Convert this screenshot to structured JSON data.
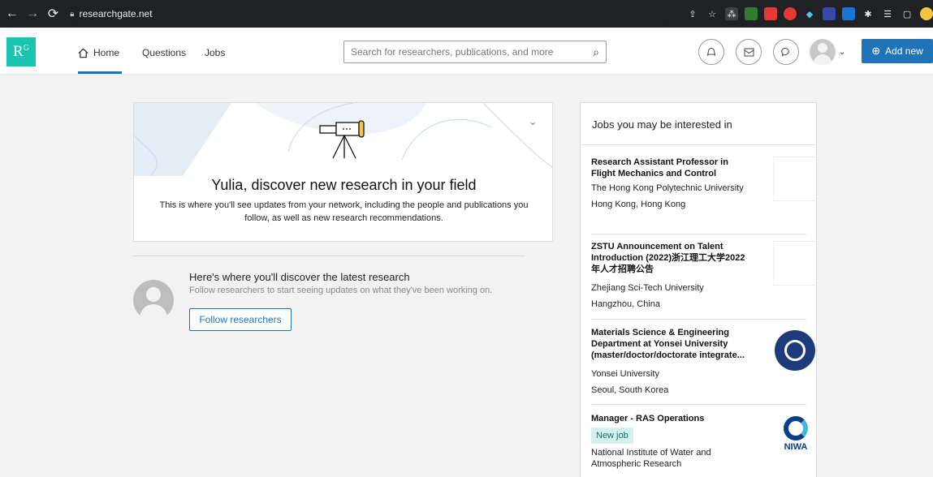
{
  "browser": {
    "url": "researchgate.net"
  },
  "header": {
    "logo_text": "R",
    "logo_sup": "G",
    "nav": [
      {
        "label": "Home"
      },
      {
        "label": "Questions"
      },
      {
        "label": "Jobs"
      }
    ],
    "search_placeholder": "Search for researchers, publications, and more",
    "add_new_label": "Add new"
  },
  "discover": {
    "title": "Yulia, discover new research in your field",
    "description": "This is where you'll see updates from your network, including the people and publications you follow, as well as new research recommendations."
  },
  "latest": {
    "title": "Here's where you'll discover the latest research",
    "subtitle": "Follow researchers to start seeing updates on what they've been working on.",
    "follow_button": "Follow researchers"
  },
  "jobs": {
    "header": "Jobs you may be interested in",
    "items": [
      {
        "title": "Research Assistant Professor in Flight Mechanics and Control",
        "org": "The Hong Kong Polytechnic University",
        "location": "Hong Kong, Hong Kong"
      },
      {
        "title": "ZSTU Announcement on Talent Introduction (2022)浙江理工大学2022年人才招聘公告",
        "org": "Zhejiang Sci-Tech University",
        "location": "Hangzhou, China"
      },
      {
        "title": "Materials Science & Engineering Department at Yonsei University (master/doctor/doctorate integrate...",
        "org": "Yonsei University",
        "location": "Seoul, South Korea"
      },
      {
        "title": "Manager - RAS Operations",
        "badge": "New job",
        "org": "National Institute of Water and Atmospheric Research",
        "logo_text": "NIWA"
      }
    ]
  }
}
